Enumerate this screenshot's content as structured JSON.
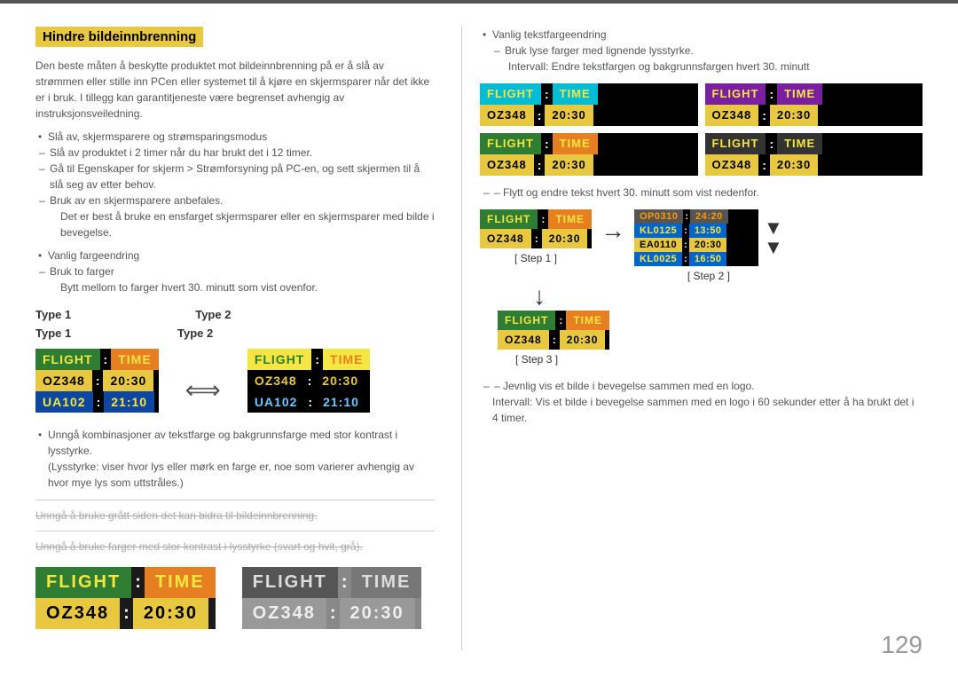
{
  "page": {
    "number": "129"
  },
  "section": {
    "title": "Hindre bildeinnbrenning",
    "intro": "Den beste måten å beskytte produktet mot bildeinnbrenning på er å slå av strømmen eller stille inn PCen eller systemet til å kjøre en skjermsparer når det ikke er i bruk. I tillegg kan garantitjeneste være begrenset avhengig av instruksjonsveiledning.",
    "bullet1": "Slå av, skjermsparere og strømsparingsmodus",
    "dash1": "Slå av produktet i 2 timer når du har brukt det i 12 timer.",
    "dash2": "Gå til Egenskaper for skjerm > Strømforsyning på PC-en, og sett skjermen til å slå seg av etter behov.",
    "dash3": "Bruk av en skjermsparere anbefales.",
    "note1": "Det er best å bruke en ensfarget skjermsparer eller en skjermsparer med bilde i bevegelse.",
    "bullet2": "Vanlig fargeendring",
    "dash4": "Bruk to farger",
    "note2": "Bytt mellom to farger hvert 30. minutt som vist ovenfor.",
    "type1_label": "Type 1",
    "type2_label": "Type 2",
    "avoid_bullet1": "Unngå kombinasjoner av tekstfarge og bakgrunnsfarge med stor kontrast i lysstyrke.",
    "avoid_note1": "(Lysstyrke: viser hvor lys eller mørk en farge er, noe som varierer avhengig av hvor mye lys som uttstråles.)",
    "strikethrough1": "Unngå å bruke grått siden det kan bidra til bildeinnbrenning.",
    "strikethrough2": "Unngå å bruke farger med stor kontrast i lysstyrke (svart og hvit, grå).",
    "bottom_section_label1": "",
    "bottom_section_label2": ""
  },
  "right_panel": {
    "bullet1": "Vanlig tekstfargeendring",
    "dash1": "Bruk lyse farger med lignende lysstyrke.",
    "note1": "Intervall: Endre tekstfargen og bakgrunnsfargen hvert 30. minutt",
    "step_intro": "–  Flytt og endre tekst hvert 30. minutt som vist nedenfor.",
    "step1_label": "[ Step 1 ]",
    "step2_label": "[ Step 2 ]",
    "step3_label": "[ Step 3 ]",
    "final_note1": "–  Jevnlig vis et bilde i bevegelse sammen med en logo.",
    "final_note2": "Intervall: Vis et bilde i bevegelse sammen med en logo i 60 sekunder etter å ha brukt det i 4 timer."
  },
  "widgets": {
    "flight_label": "FLIGHT",
    "time_label": "TIME",
    "colon": ":",
    "oz348": "OZ348",
    "ua102": "UA102",
    "time1": "20:30",
    "time2": "21:10",
    "scroll_rows": [
      {
        "flight": "OP0310",
        "time": "24:20"
      },
      {
        "flight": "KL0125",
        "time": "13:50"
      },
      {
        "flight": "EA0110",
        "time": "20:30"
      },
      {
        "flight": "KL0025",
        "time": "16:50"
      }
    ]
  },
  "colors": {
    "yellow": "#e8c840",
    "green": "#2e7d32",
    "orange": "#e67e22",
    "blue": "#0066cc",
    "cyan": "#00bcd4",
    "purple": "#7b1fa2",
    "dark_gray": "#555555",
    "black": "#000000",
    "white": "#ffffff"
  }
}
